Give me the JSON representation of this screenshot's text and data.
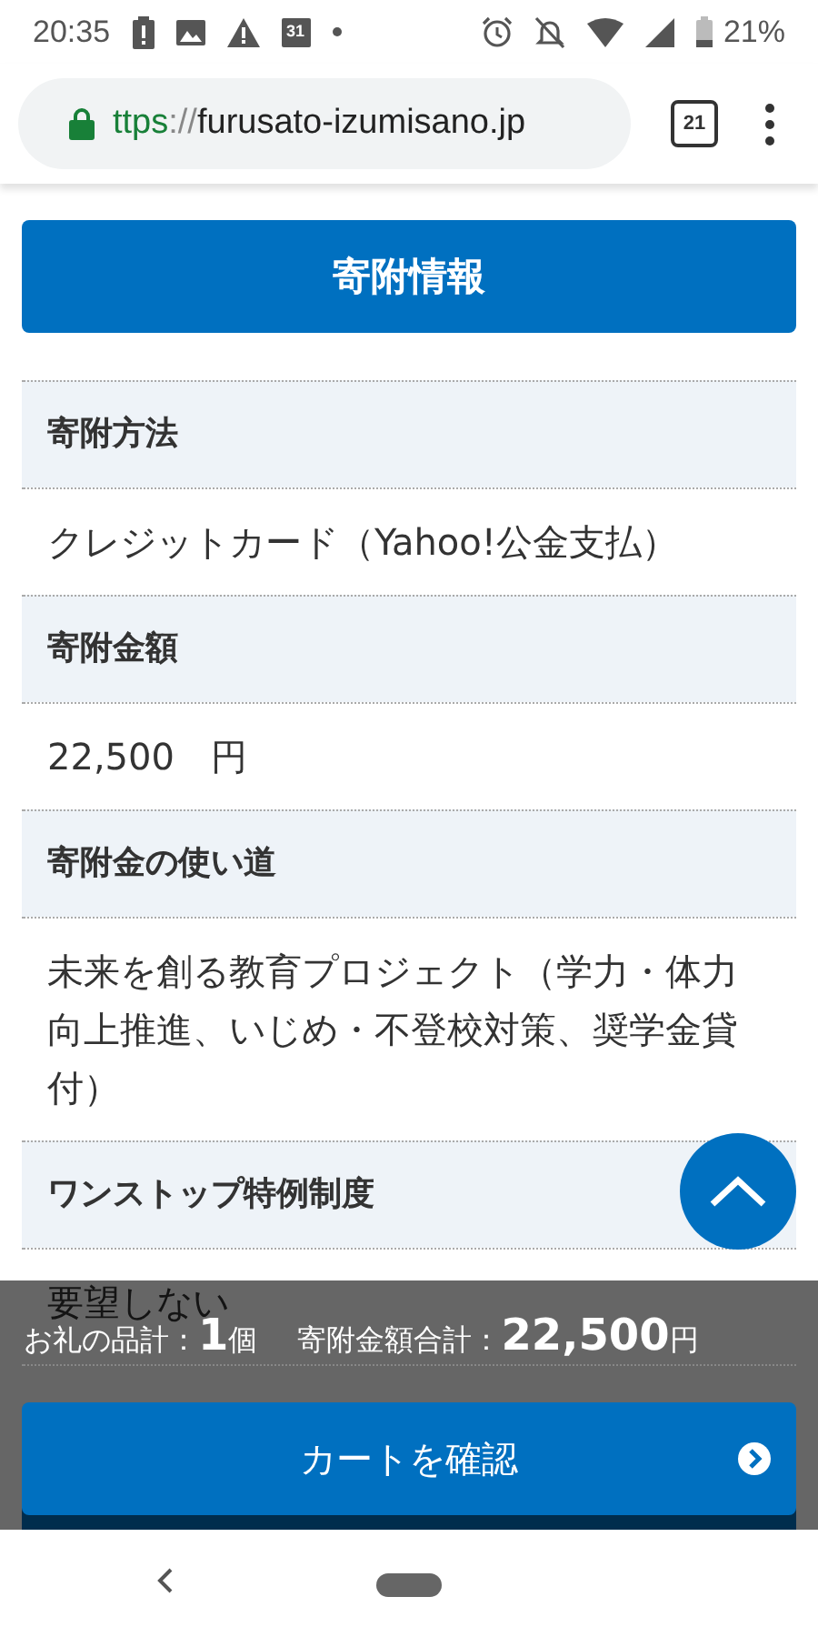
{
  "status_bar": {
    "time": "20:35",
    "calendar_day": "31",
    "battery": "21%"
  },
  "browser": {
    "url_scheme": "ttps",
    "url_separator": "://",
    "url_host": "furusato-izumisano.jp",
    "tab_count": "21"
  },
  "section_header": "寄附情報",
  "fields": [
    {
      "label": "寄附方法",
      "value": "クレジットカード（Yahoo!公金支払）"
    },
    {
      "label": "寄附金額",
      "value": "22,500　円"
    },
    {
      "label": "寄附金の使い道",
      "value": "未来を創る教育プロジェクト（学力・体力向上推進、いじめ・不登校対策、奨学金貸付）"
    },
    {
      "label": "ワンストップ特例制度",
      "value": "要望しない"
    }
  ],
  "footer": {
    "items_label": "お礼の品計：",
    "items_count": "1",
    "items_unit": "個",
    "total_label": "寄附金額合計：",
    "total": "22,500",
    "currency": "円",
    "button": "カートを確認"
  }
}
